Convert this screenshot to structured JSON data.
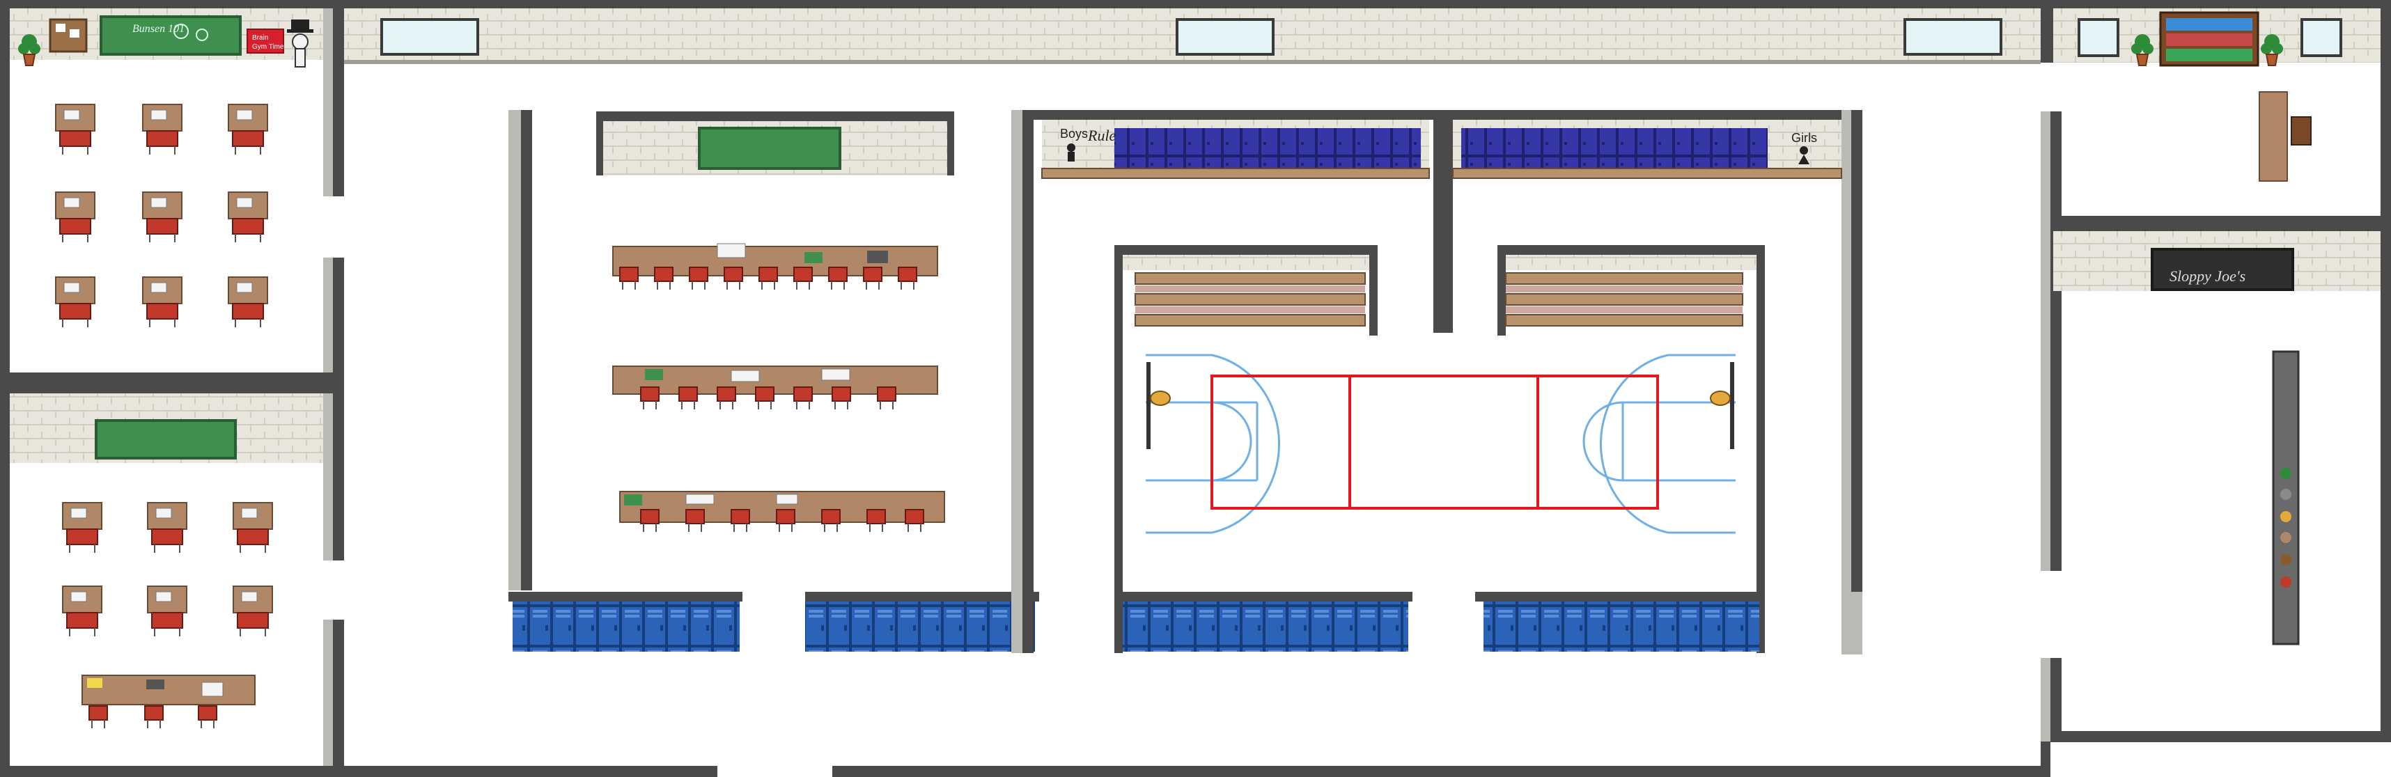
{
  "map": {
    "colors": {
      "wall_dark": "#4a4a4a",
      "wall_side": "#b9bab3",
      "brick": "#e8e6dc",
      "brick_line": "#c9c6b8",
      "floor": "#ffffff",
      "chalkboard_green": "#3f8f4f",
      "blackboard": "#2f2f2f",
      "desk": "#b08868",
      "chair": "#c0392b",
      "locker_blue": "#2b63b8",
      "locker_blue_dark": "#1d478d",
      "gym_locker_purple": "#3537a6",
      "bench_wood": "#b8926a",
      "court_red": "#e8141e",
      "court_blue": "#6fb0e6",
      "plant": "#2e8b3a",
      "pot": "#b35a2e"
    },
    "signs": {
      "boys": "Boys",
      "rule": "Rule",
      "girls": "Girls",
      "art_sign": "Sloppy Joe's",
      "red_board": "Brain Gym Time"
    }
  }
}
